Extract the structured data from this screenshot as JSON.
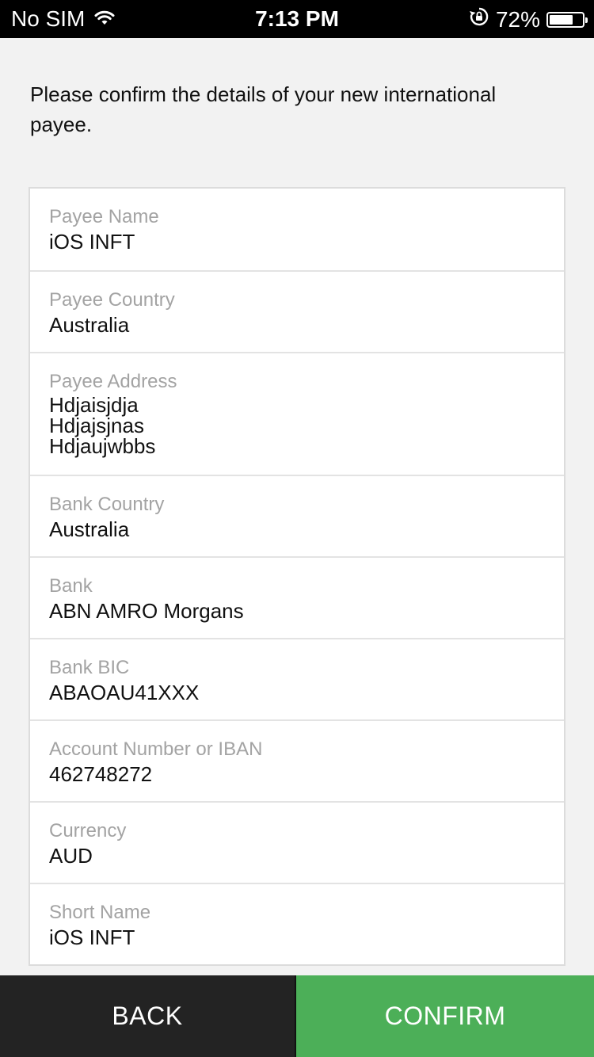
{
  "status_bar": {
    "carrier": "No SIM",
    "time": "7:13 PM",
    "battery_percent": "72%",
    "battery_level": 0.72,
    "icons": [
      "wifi-icon",
      "rotation-lock-icon",
      "battery-icon"
    ]
  },
  "intro_text": "Please confirm the details of your new international payee.",
  "fields": [
    {
      "label": "Payee Name",
      "value": "iOS INFT"
    },
    {
      "label": "Payee Country",
      "value": "Australia"
    },
    {
      "label": "Payee Address",
      "lines": [
        "Hdjaisjdja",
        "Hdjajsjnas",
        "Hdjaujwbbs"
      ]
    },
    {
      "label": "Bank Country",
      "value": "Australia"
    },
    {
      "label": "Bank",
      "value": "ABN AMRO Morgans"
    },
    {
      "label": "Bank BIC",
      "value": "ABAOAU41XXX"
    },
    {
      "label": "Account Number or IBAN",
      "value": "462748272"
    },
    {
      "label": "Currency",
      "value": "AUD"
    },
    {
      "label": "Short Name",
      "value": "iOS INFT"
    }
  ],
  "buttons": {
    "back_label": "BACK",
    "confirm_label": "CONFIRM"
  },
  "colors": {
    "confirm": "#4caf58",
    "back": "#232323",
    "label": "#a3a3a3",
    "background": "#f2f2f2"
  }
}
